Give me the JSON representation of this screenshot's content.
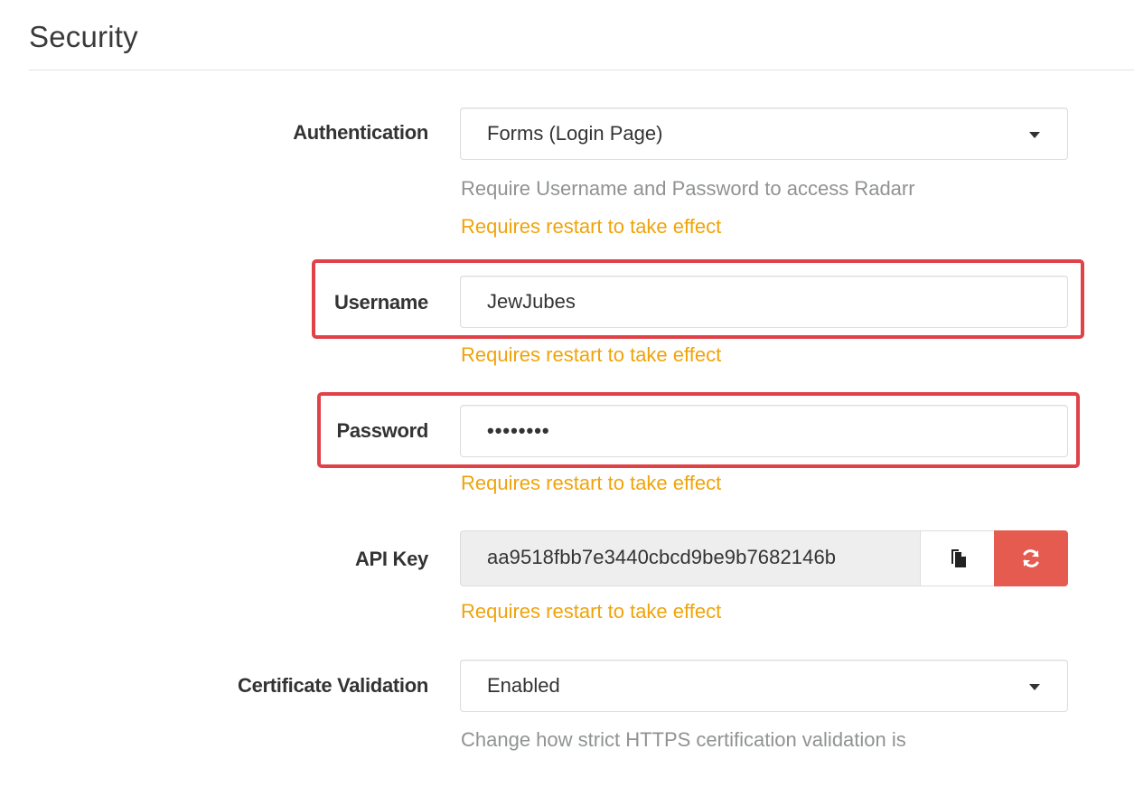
{
  "section": {
    "title": "Security"
  },
  "authentication": {
    "label": "Authentication",
    "selected": "Forms (Login Page)",
    "help": "Require Username and Password to access Radarr",
    "warning": "Requires restart to take effect"
  },
  "username": {
    "label": "Username",
    "value": "JewJubes",
    "warning": "Requires restart to take effect"
  },
  "password": {
    "label": "Password",
    "value": "••••••••",
    "warning": "Requires restart to take effect"
  },
  "api_key": {
    "label": "API Key",
    "value": "aa9518fbb7e3440cbcd9be9b7682146b",
    "warning": "Requires restart to take effect"
  },
  "certificate_validation": {
    "label": "Certificate Validation",
    "selected": "Enabled",
    "help": "Change how strict HTTPS certification validation is"
  },
  "icons": {
    "copy": "copy-icon",
    "regenerate": "refresh-icon",
    "dropdown": "caret-down-icon"
  },
  "colors": {
    "warning": "#f0a30a",
    "help": "#909293",
    "danger_button": "#e55b4f",
    "highlight_box": "#e04248"
  }
}
